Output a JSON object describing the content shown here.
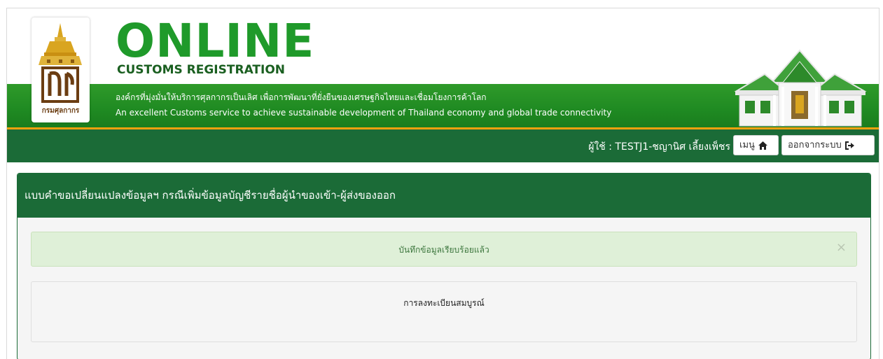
{
  "header": {
    "logo_caption": "กรมศุลกากร",
    "brand_title": "ONLINE",
    "brand_subtitle": "CUSTOMS REGISTRATION",
    "tagline_thai": "องค์กรที่มุ่งมั่นให้บริการศุลกากรเป็นเลิศ เพื่อการพัฒนาที่ยั่งยืนของเศรษฐกิจไทยและเชื่อมโยงการค้าโลก",
    "tagline_en": "An excellent Customs service to achieve sustainable development of Thailand economy and global trade connectivity"
  },
  "userbar": {
    "user_label": "ผู้ใช้ : TESTJ1-ชญานิศ เลี้ยงเพ็ชร",
    "menu_label": "เมนู",
    "menu_icon": "home-icon",
    "logout_label": "ออกจากระบบ",
    "logout_icon": "sign-out-icon"
  },
  "panel": {
    "title": "แบบคำขอเปลี่ยนแปลงข้อมูลฯ กรณีเพิ่มข้อมูลบัญชีรายชื่อผู้นำของเข้า-ผู้ส่งของออก",
    "alert_message": "บันทึกข้อมูลเรียบร้อยแล้ว",
    "alert_close": "×",
    "status_text": "การลงทะเบียนสมบูรณ์"
  },
  "colors": {
    "header_green": "#1f8a22",
    "dark_green": "#1b6b37",
    "accent_orange": "#f4a10f",
    "alert_bg": "#dff0d8"
  }
}
